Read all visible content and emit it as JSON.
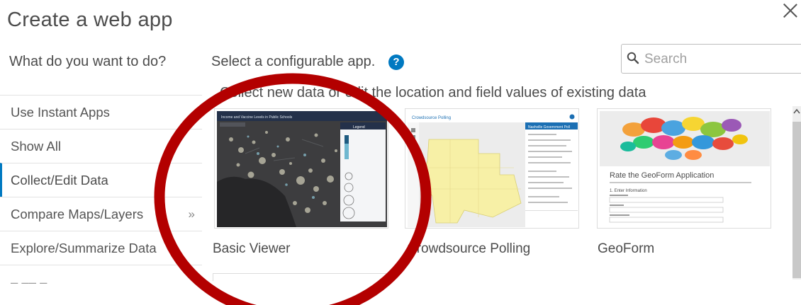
{
  "dialog": {
    "title": "Create a web app"
  },
  "sidebar": {
    "question": "What do you want to do?",
    "items": [
      {
        "label": "Use Instant Apps"
      },
      {
        "label": "Show All"
      },
      {
        "label": "Collect/Edit Data"
      },
      {
        "label": "Compare Maps/Layers",
        "chevron": "»"
      },
      {
        "label": "Explore/Summarize Data"
      }
    ]
  },
  "main": {
    "select_label": "Select a configurable app.",
    "help_icon": "?",
    "category_heading": "Collect new data or edit the location and field values of existing data",
    "cards": [
      {
        "name": "Basic Viewer",
        "thumb": {
          "header": "Income and Vaccine Levels in Public Schools",
          "legend_title": "Legend"
        }
      },
      {
        "name": "Crowdsource Polling",
        "thumb": {
          "header": "Crowdsource Polling",
          "panel_title": "Nashville Government Poll"
        }
      },
      {
        "name": "GeoForm",
        "thumb": {
          "heading": "Rate the GeoForm Application",
          "step": "1. Enter Information"
        }
      }
    ]
  },
  "search": {
    "placeholder": "Search",
    "value": ""
  },
  "colors": {
    "accent": "#0079c1",
    "annotation": "#b30000"
  }
}
